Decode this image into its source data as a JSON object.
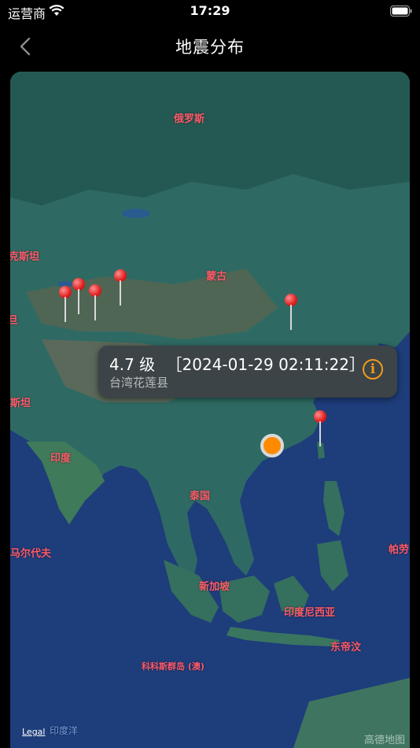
{
  "status": {
    "carrier": "运营商",
    "time": "17:29"
  },
  "nav": {
    "title": "地震分布"
  },
  "map": {
    "labels": {
      "russia": "俄罗斯",
      "kazakhstan": "克斯坦",
      "mongolia": "蒙古",
      "stan_left": "旦",
      "pakistan": "斯坦",
      "india": "印度",
      "thailand": "泰国",
      "maldives": "马尔代夫",
      "singapore": "新加坡",
      "indonesia": "印度尼西亚",
      "east_timor": "东帝汶",
      "cocos": "科科斯群岛 (澳)",
      "palau": "帕劳",
      "indian_ocean": "印度洋"
    },
    "legal": "Legal",
    "watermark": "高德地图"
  },
  "callout": {
    "magnitude": "4.7 级",
    "datetime": "［2024-01-29 02:11:22］",
    "place": "台湾花莲县",
    "info_icon": "i"
  }
}
